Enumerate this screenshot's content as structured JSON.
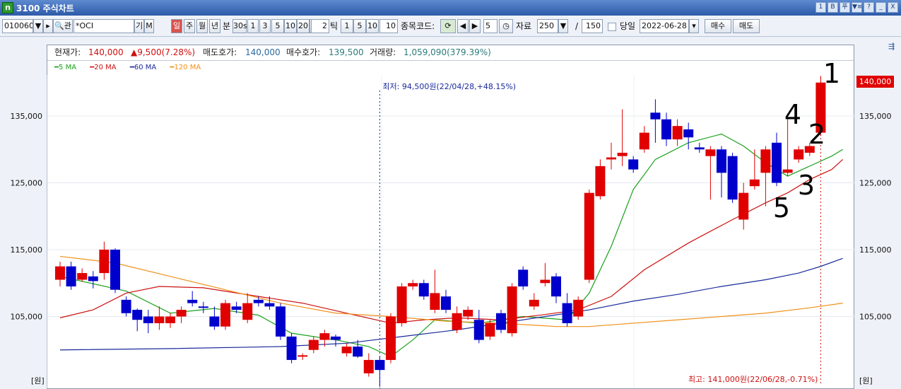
{
  "window": {
    "title": "3100 주식차트",
    "icon": "app-icon-n",
    "icon_glyph": "n"
  },
  "titlebar_buttons": [
    "1",
    "B",
    "푸",
    "▼≡",
    "?",
    "_",
    "X"
  ],
  "toolbar": {
    "stock_code": "010060",
    "search_icon": "magnifier-icon",
    "search_label": "관",
    "stock_name": "*OCI",
    "gi_label": "기",
    "m_label": "M",
    "period_tabs": [
      "일",
      "주",
      "월",
      "년"
    ],
    "period_selected": "일",
    "bun_label": "분",
    "minute_buttons": [
      "30s",
      "1",
      "3",
      "5",
      "10",
      "20",
      "30"
    ],
    "tick_value": "2",
    "tick_label": "틱",
    "tick_buttons": [
      "1",
      "5",
      "10"
    ],
    "tick_input": "10",
    "code_label": "종목코드:",
    "count_value": "5",
    "data_label": "자료",
    "data_count": "250",
    "slash": "/",
    "data_visible": "150",
    "today_label": "당일",
    "date_value": "2022-06-28",
    "buy_button": "매수",
    "sell_button": "매도"
  },
  "infobar": {
    "current_label": "현재가:",
    "current_value": "140,000",
    "change_value": "▲9,500(7.28%)",
    "ask_label": "매도호가:",
    "ask_value": "140,000",
    "bid_label": "매수호가:",
    "bid_value": "139,500",
    "volume_label": "거래량:",
    "volume_value": "1,059,090(379.39%)"
  },
  "legend": [
    {
      "label": "5 MA",
      "color": "#1aa01a"
    },
    {
      "label": "20 MA",
      "color": "#cc1111"
    },
    {
      "label": "60 MA",
      "color": "#1a2a9a"
    },
    {
      "label": "120 MA",
      "color": "#f0901a"
    }
  ],
  "colors": {
    "up": "#e00000",
    "down": "#0000cc"
  },
  "annotations": {
    "low": "최저: 94,500원(22/04/28,+48.15%)",
    "high": "최고: 141,000원(22/06/28,-0.71%)",
    "numbers": [
      "1",
      "2",
      "3",
      "4",
      "5"
    ]
  },
  "unit_label": "[원]",
  "price_flag": "140,000",
  "chart_data": {
    "type": "candlestick",
    "y_ticks": [
      "135,000",
      "125,000",
      "115,000",
      "105,000"
    ],
    "ylim": [
      99500,
      142500
    ],
    "candles": [
      {
        "o": 110.5,
        "c": 112.5,
        "h": 113.2,
        "l": 109.5
      },
      {
        "o": 112.5,
        "c": 109.5,
        "h": 113.2,
        "l": 109.0
      },
      {
        "o": 110.5,
        "c": 111.5,
        "h": 112.2,
        "l": 110.2
      },
      {
        "o": 111.0,
        "c": 110.3,
        "h": 111.8,
        "l": 109.2
      },
      {
        "o": 111.5,
        "c": 115.0,
        "h": 116.2,
        "l": 110.5
      },
      {
        "o": 115.0,
        "c": 109.0,
        "h": 115.2,
        "l": 108.5
      },
      {
        "o": 107.5,
        "c": 105.5,
        "h": 108.0,
        "l": 105.0
      },
      {
        "o": 106.0,
        "c": 104.5,
        "h": 106.2,
        "l": 102.8
      },
      {
        "o": 105.0,
        "c": 104.0,
        "h": 106.0,
        "l": 102.5
      },
      {
        "o": 104.0,
        "c": 105.0,
        "h": 106.5,
        "l": 103.0
      },
      {
        "o": 104.0,
        "c": 105.0,
        "h": 105.5,
        "l": 103.3
      },
      {
        "o": 105.0,
        "c": 106.0,
        "h": 106.5,
        "l": 104.0
      },
      {
        "o": 107.5,
        "c": 107.0,
        "h": 108.8,
        "l": 106.5
      },
      {
        "o": 106.5,
        "c": 106.3,
        "h": 107.2,
        "l": 105.5
      },
      {
        "o": 105.0,
        "c": 103.5,
        "h": 106.5,
        "l": 103.0
      },
      {
        "o": 103.5,
        "c": 107.0,
        "h": 107.5,
        "l": 103.0
      },
      {
        "o": 106.5,
        "c": 106.0,
        "h": 107.2,
        "l": 105.5
      },
      {
        "o": 104.5,
        "c": 107.0,
        "h": 108.5,
        "l": 104.0
      },
      {
        "o": 107.5,
        "c": 107.0,
        "h": 108.0,
        "l": 106.5
      },
      {
        "o": 107.0,
        "c": 106.5,
        "h": 108.0,
        "l": 106.0
      },
      {
        "o": 106.5,
        "c": 102.0,
        "h": 107.0,
        "l": 101.5
      },
      {
        "o": 102.0,
        "c": 98.5,
        "h": 102.5,
        "l": 98.0
      },
      {
        "o": 99.0,
        "c": 99.2,
        "h": 99.5,
        "l": 98.5
      },
      {
        "o": 100.0,
        "c": 101.5,
        "h": 102.0,
        "l": 99.5
      },
      {
        "o": 101.5,
        "c": 102.5,
        "h": 103.0,
        "l": 100.5
      },
      {
        "o": 102.0,
        "c": 101.5,
        "h": 102.3,
        "l": 100.5
      },
      {
        "o": 99.5,
        "c": 100.5,
        "h": 101.0,
        "l": 99.0
      },
      {
        "o": 100.5,
        "c": 99.0,
        "h": 101.5,
        "l": 98.8
      },
      {
        "o": 96.5,
        "c": 98.5,
        "h": 99.5,
        "l": 96.0
      },
      {
        "o": 98.5,
        "c": 97.0,
        "h": 99.0,
        "l": 94.5
      },
      {
        "o": 98.5,
        "c": 105.0,
        "h": 105.5,
        "l": 98.0
      },
      {
        "o": 104.0,
        "c": 109.5,
        "h": 110.0,
        "l": 103.5
      },
      {
        "o": 109.5,
        "c": 110.0,
        "h": 110.5,
        "l": 109.0
      },
      {
        "o": 110.0,
        "c": 108.0,
        "h": 110.5,
        "l": 107.5
      },
      {
        "o": 106.0,
        "c": 108.5,
        "h": 112.0,
        "l": 105.5
      },
      {
        "o": 108.0,
        "c": 106.0,
        "h": 109.0,
        "l": 105.5
      },
      {
        "o": 103.0,
        "c": 105.5,
        "h": 106.5,
        "l": 102.5
      },
      {
        "o": 105.0,
        "c": 106.0,
        "h": 106.5,
        "l": 104.5
      },
      {
        "o": 104.5,
        "c": 101.5,
        "h": 106.0,
        "l": 101.0
      },
      {
        "o": 102.0,
        "c": 104.0,
        "h": 104.5,
        "l": 101.5
      },
      {
        "o": 105.5,
        "c": 103.0,
        "h": 106.0,
        "l": 102.5
      },
      {
        "o": 102.5,
        "c": 109.5,
        "h": 110.0,
        "l": 102.0
      },
      {
        "o": 112.0,
        "c": 109.5,
        "h": 112.5,
        "l": 109.0
      },
      {
        "o": 106.5,
        "c": 107.5,
        "h": 108.5,
        "l": 106.0
      },
      {
        "o": 110.0,
        "c": 110.5,
        "h": 113.0,
        "l": 109.5
      },
      {
        "o": 111.0,
        "c": 108.0,
        "h": 111.5,
        "l": 107.0
      },
      {
        "o": 107.0,
        "c": 104.0,
        "h": 108.5,
        "l": 103.5
      },
      {
        "o": 105.0,
        "c": 107.5,
        "h": 108.0,
        "l": 104.5
      },
      {
        "o": 110.5,
        "c": 123.5,
        "h": 124.0,
        "l": 110.0
      },
      {
        "o": 123.0,
        "c": 127.5,
        "h": 128.5,
        "l": 122.5
      },
      {
        "o": 128.5,
        "c": 128.8,
        "h": 131.0,
        "l": 127.0
      },
      {
        "o": 129.0,
        "c": 129.5,
        "h": 136.0,
        "l": 127.5
      },
      {
        "o": 128.5,
        "c": 127.0,
        "h": 129.0,
        "l": 126.5
      },
      {
        "o": 130.0,
        "c": 132.5,
        "h": 133.5,
        "l": 129.5
      },
      {
        "o": 135.5,
        "c": 134.5,
        "h": 137.5,
        "l": 131.0
      },
      {
        "o": 134.5,
        "c": 131.5,
        "h": 135.5,
        "l": 130.5
      },
      {
        "o": 131.5,
        "c": 133.5,
        "h": 134.5,
        "l": 130.5
      },
      {
        "o": 133.0,
        "c": 131.8,
        "h": 134.0,
        "l": 130.0
      },
      {
        "o": 130.3,
        "c": 130.0,
        "h": 131.0,
        "l": 129.5
      },
      {
        "o": 129.0,
        "c": 130.0,
        "h": 130.5,
        "l": 122.5
      },
      {
        "o": 130.0,
        "c": 126.5,
        "h": 130.5,
        "l": 122.8
      },
      {
        "o": 129.0,
        "c": 122.5,
        "h": 129.5,
        "l": 122.0
      },
      {
        "o": 119.5,
        "c": 123.5,
        "h": 125.0,
        "l": 118.0
      },
      {
        "o": 124.5,
        "c": 125.5,
        "h": 130.0,
        "l": 124.0
      },
      {
        "o": 126.5,
        "c": 130.0,
        "h": 130.5,
        "l": 121.5
      },
      {
        "o": 131.0,
        "c": 125.0,
        "h": 132.5,
        "l": 124.5
      },
      {
        "o": 126.5,
        "c": 127.0,
        "h": 134.5,
        "l": 126.0
      },
      {
        "o": 128.5,
        "c": 130.0,
        "h": 130.5,
        "l": 128.0
      },
      {
        "o": 129.5,
        "c": 130.5,
        "h": 131.0,
        "l": 129.0
      },
      {
        "o": 132.5,
        "c": 140.0,
        "h": 141.0,
        "l": 132.0
      }
    ],
    "ma": {
      "5 MA": [
        [
          0,
          111
        ],
        [
          6,
          108.8
        ],
        [
          10,
          105.5
        ],
        [
          14,
          106.2
        ],
        [
          18,
          105.2
        ],
        [
          21,
          102.5
        ],
        [
          25,
          101.5
        ],
        [
          28,
          100.5
        ],
        [
          30,
          99.0
        ],
        [
          32,
          101.5
        ],
        [
          34,
          104.5
        ],
        [
          38,
          104.0
        ],
        [
          42,
          105.0
        ],
        [
          46,
          104.5
        ],
        [
          48,
          108.5
        ],
        [
          50,
          115.5
        ],
        [
          52,
          124.0
        ],
        [
          54,
          128.5
        ],
        [
          57,
          131.0
        ],
        [
          60,
          132.3
        ],
        [
          62,
          130.5
        ],
        [
          64,
          128.0
        ],
        [
          66,
          126.0
        ],
        [
          68,
          127.5
        ],
        [
          70,
          129.0
        ],
        [
          71,
          130.0
        ]
      ],
      "20 MA": [
        [
          0,
          104.8
        ],
        [
          3,
          106.0
        ],
        [
          6,
          108.5
        ],
        [
          9,
          109.5
        ],
        [
          13,
          109.3
        ],
        [
          18,
          108.0
        ],
        [
          22,
          107.0
        ],
        [
          26,
          105.5
        ],
        [
          30,
          104.0
        ],
        [
          33,
          104.5
        ],
        [
          36,
          104.8
        ],
        [
          40,
          104.5
        ],
        [
          44,
          105.3
        ],
        [
          47,
          106.0
        ],
        [
          50,
          108.0
        ],
        [
          53,
          112.0
        ],
        [
          57,
          116.0
        ],
        [
          61,
          119.5
        ],
        [
          64,
          122.0
        ],
        [
          66,
          123.5
        ],
        [
          68,
          125.5
        ],
        [
          70,
          127.0
        ],
        [
          71,
          128.5
        ]
      ],
      "60 MA": [
        [
          0,
          100.0
        ],
        [
          10,
          100.2
        ],
        [
          20,
          100.5
        ],
        [
          26,
          101.0
        ],
        [
          31,
          102.0
        ],
        [
          36,
          103.0
        ],
        [
          40,
          104.0
        ],
        [
          44,
          105.0
        ],
        [
          48,
          106.0
        ],
        [
          52,
          107.3
        ],
        [
          56,
          108.3
        ],
        [
          60,
          109.5
        ],
        [
          64,
          110.5
        ],
        [
          67,
          111.5
        ],
        [
          69,
          112.5
        ],
        [
          71,
          113.7
        ]
      ],
      "120 MA": [
        [
          0,
          114.0
        ],
        [
          5,
          113.0
        ],
        [
          10,
          111.0
        ],
        [
          15,
          109.0
        ],
        [
          20,
          107.0
        ],
        [
          25,
          105.5
        ],
        [
          30,
          105.0
        ],
        [
          35,
          104.3
        ],
        [
          40,
          104.0
        ],
        [
          45,
          103.5
        ],
        [
          48,
          103.5
        ],
        [
          52,
          104.0
        ],
        [
          56,
          104.5
        ],
        [
          60,
          105.0
        ],
        [
          64,
          105.5
        ],
        [
          68,
          106.3
        ],
        [
          71,
          107.0
        ]
      ]
    }
  }
}
